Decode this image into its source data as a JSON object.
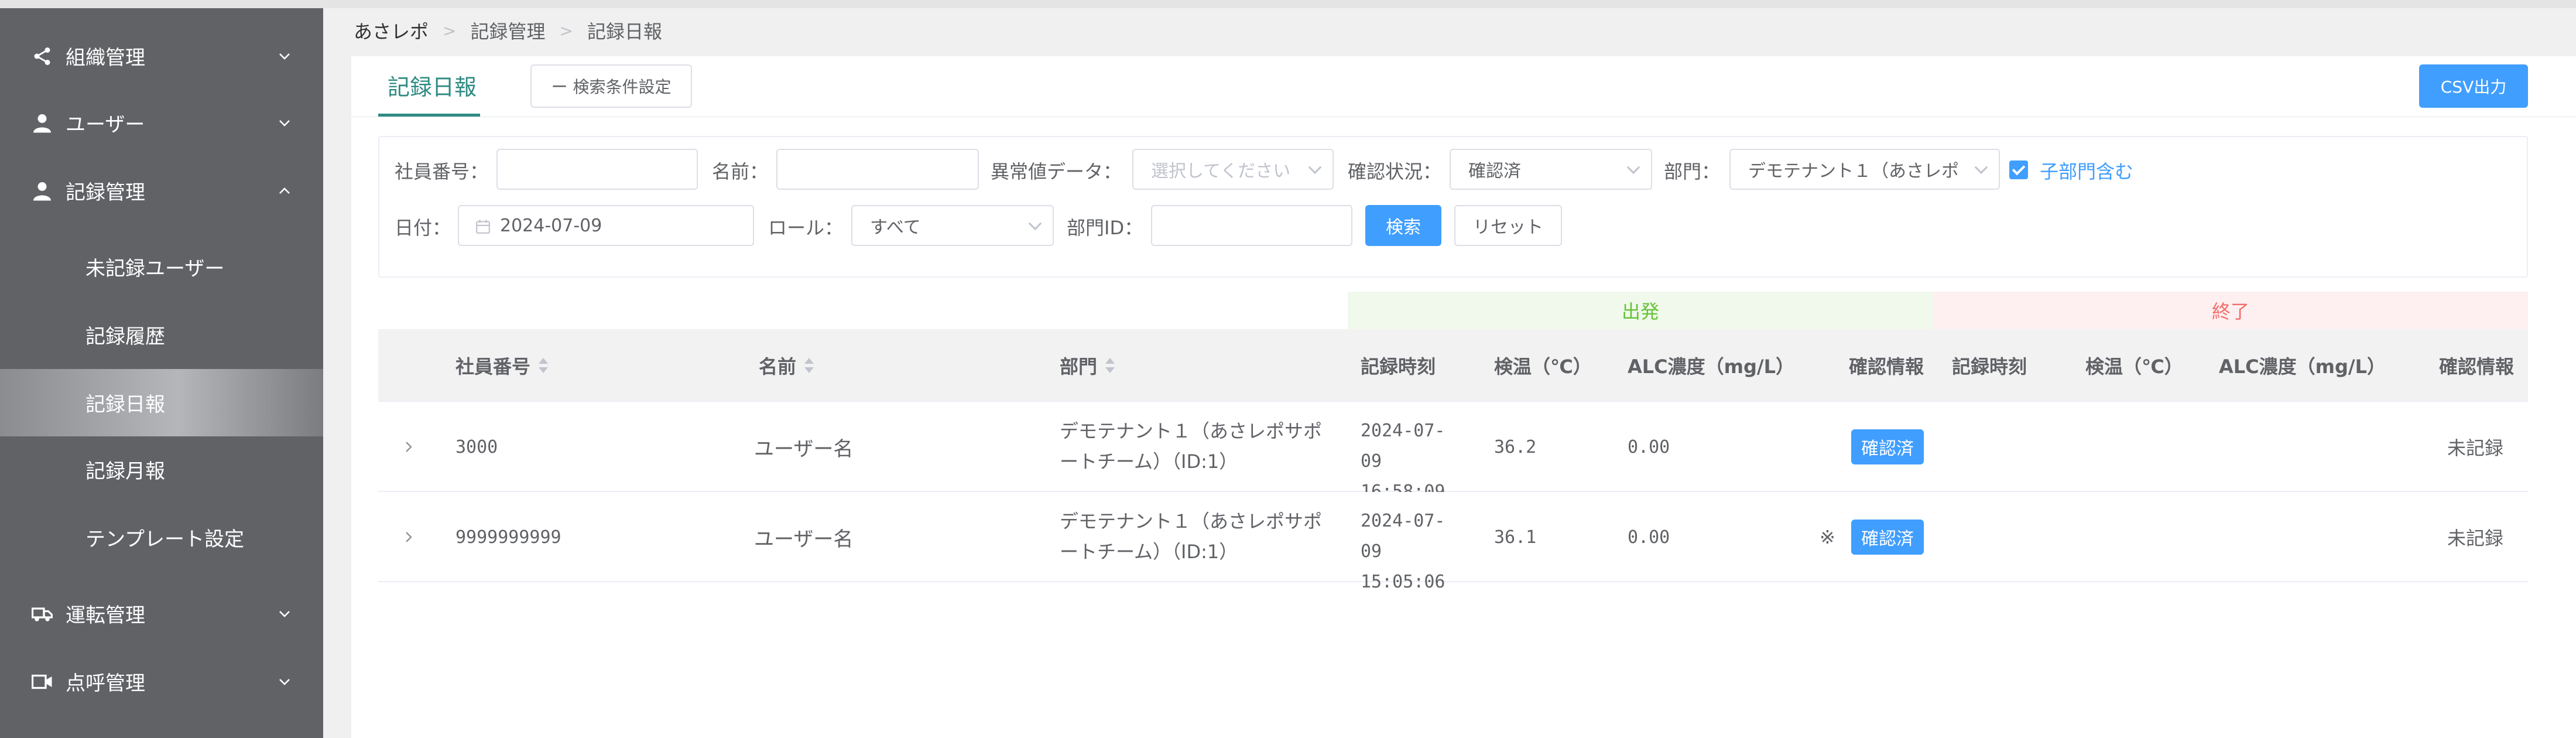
{
  "sidebar": {
    "items": [
      {
        "label": "組織管理",
        "icon": "share-icon"
      },
      {
        "label": "ユーザー",
        "icon": "user-icon"
      },
      {
        "label": "記録管理",
        "icon": "user-icon"
      },
      {
        "label": "運転管理",
        "icon": "truck-icon"
      },
      {
        "label": "点呼管理",
        "icon": "video-icon"
      }
    ],
    "sub_items": [
      {
        "label": "未記録ユーザー"
      },
      {
        "label": "記録履歴"
      },
      {
        "label": "記録日報",
        "active": true
      },
      {
        "label": "記録月報"
      },
      {
        "label": "テンプレート設定"
      }
    ]
  },
  "breadcrumb": [
    "あさレポ",
    "記録管理",
    "記録日報"
  ],
  "page": {
    "tab_label": "記録日報",
    "search_condition_button": "ー 検索条件設定",
    "csv_button": "CSV出力"
  },
  "filters": {
    "employee_no_label": "社員番号：",
    "employee_no_value": "",
    "name_label": "名前：",
    "name_value": "",
    "abnormal_label": "異常値データ：",
    "abnormal_placeholder": "選択してください",
    "status_label": "確認状況：",
    "status_value": "確認済",
    "department_label": "部門：",
    "department_value": "デモテナント１（あさレポ",
    "include_sub_label": "子部門含む",
    "date_label": "日付：",
    "date_value": "2024-07-09",
    "role_label": "ロール：",
    "role_value": "すべて",
    "dept_id_label": "部門ID：",
    "dept_id_value": "",
    "search_button": "検索",
    "reset_button": "リセット"
  },
  "table": {
    "group_start": "出発",
    "group_end": "終了",
    "headers": {
      "employee_no": "社員番号",
      "name": "名前",
      "department": "部門",
      "start_time": "記録時刻",
      "start_temp": "検温（℃）",
      "start_alc": "ALC濃度（mg/L）",
      "start_check": "確認情報",
      "end_time": "記録時刻",
      "end_temp": "検温（℃）",
      "end_alc": "ALC濃度（mg/L）",
      "end_check": "確認情報"
    },
    "rows": [
      {
        "employee_no": "3000",
        "name": "ユーザー名",
        "department": "デモテナント１（あさレポサポートチーム）（ID:1）",
        "start_time": "2024-07-09 16:58:09",
        "start_temp": "36.2",
        "start_alc": "0.00",
        "mark": "",
        "start_check": "確認済",
        "end_check": "未記録"
      },
      {
        "employee_no": "9999999999",
        "name": "ユーザー名",
        "department": "デモテナント１（あさレポサポートチーム）（ID:1）",
        "start_time": "2024-07-09 15:05:06",
        "start_temp": "36.1",
        "start_alc": "0.00",
        "mark": "※",
        "start_check": "確認済",
        "end_check": "未記録"
      }
    ]
  },
  "colors": {
    "sidebar_bg": "#606266",
    "primary": "#409eff",
    "tab_accent": "#2e8b83",
    "start_group_bg": "#f0f9eb",
    "start_group_text": "#67c23a",
    "end_group_bg": "#fef0f0",
    "end_group_text": "#f56c6c"
  }
}
